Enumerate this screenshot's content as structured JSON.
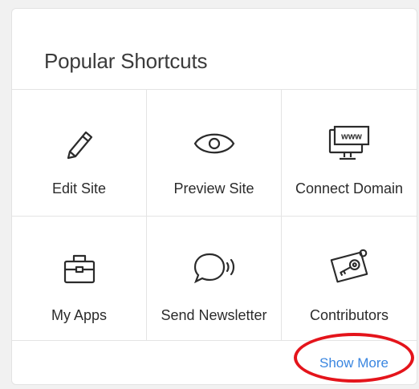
{
  "panel": {
    "title": "Popular Shortcuts"
  },
  "shortcuts": [
    {
      "label": "Edit Site",
      "icon": "pencil-icon"
    },
    {
      "label": "Preview Site",
      "icon": "eye-icon"
    },
    {
      "label": "Connect Domain",
      "icon": "www-monitor-icon"
    },
    {
      "label": "My Apps",
      "icon": "briefcase-icon"
    },
    {
      "label": "Send Newsletter",
      "icon": "speech-bubble-icon"
    },
    {
      "label": "Contributors",
      "icon": "key-card-icon"
    }
  ],
  "footer": {
    "show_more_label": "Show More"
  },
  "icon_glyphs": {
    "www_text": "www"
  },
  "colors": {
    "link": "#3a86e0",
    "annotation": "#e4141b",
    "text": "#2b2b2b"
  }
}
